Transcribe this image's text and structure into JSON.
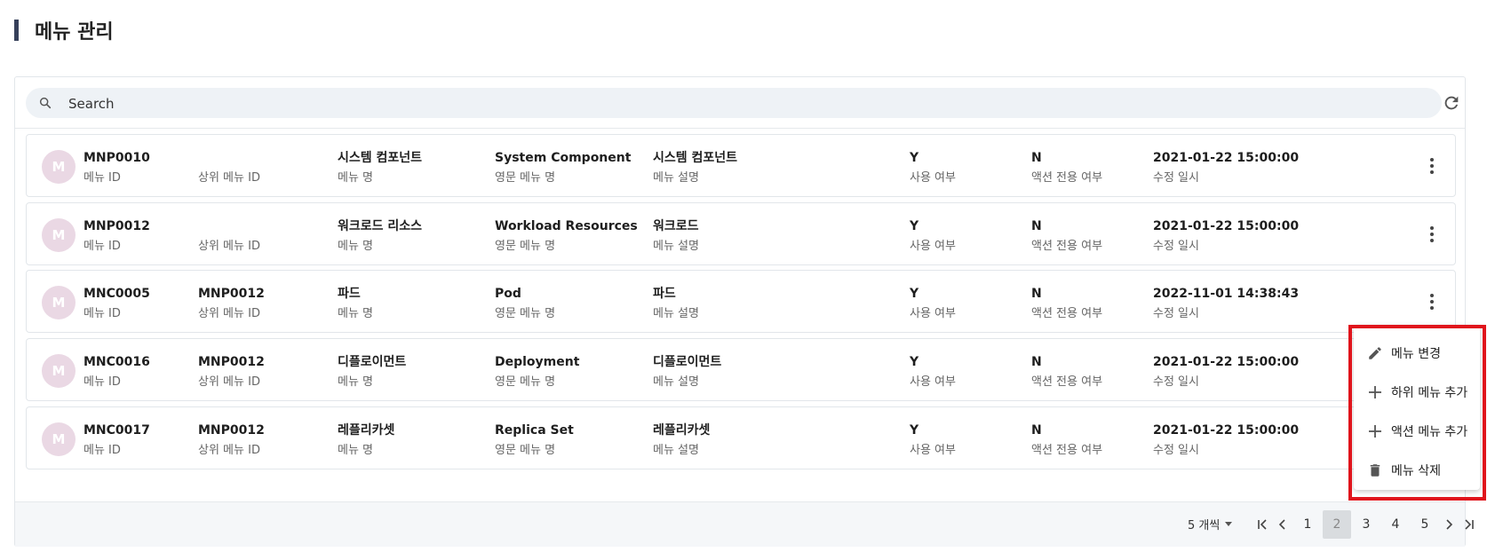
{
  "page": {
    "title": "메뉴 관리"
  },
  "search": {
    "placeholder": "Search"
  },
  "icons": {
    "search": "search-icon",
    "refresh": "refresh-icon",
    "more": "more-vertical-icon"
  },
  "labels": {
    "menu_id": "메뉴 ID",
    "parent_id": "상위 메뉴 ID",
    "menu_name": "메뉴 명",
    "eng_name": "영문 메뉴 명",
    "desc": "메뉴 설명",
    "use_yn": "사용 여부",
    "action_yn": "액션 전용 여부",
    "updated": "수정 일시"
  },
  "rows": [
    {
      "avatar": "M",
      "menu_id": "MNP0010",
      "parent_id": "",
      "menu_name": "시스템 컴포넌트",
      "eng_name": "System Component",
      "desc": "시스템 컴포넌트",
      "use_yn": "Y",
      "action_yn": "N",
      "updated": "2021-01-22 15:00:00"
    },
    {
      "avatar": "M",
      "menu_id": "MNP0012",
      "parent_id": "",
      "menu_name": "워크로드 리소스",
      "eng_name": "Workload Resources",
      "desc": "워크로드",
      "use_yn": "Y",
      "action_yn": "N",
      "updated": "2021-01-22 15:00:00"
    },
    {
      "avatar": "M",
      "menu_id": "MNC0005",
      "parent_id": "MNP0012",
      "menu_name": "파드",
      "eng_name": "Pod",
      "desc": "파드",
      "use_yn": "Y",
      "action_yn": "N",
      "updated": "2022-11-01 14:38:43"
    },
    {
      "avatar": "M",
      "menu_id": "MNC0016",
      "parent_id": "MNP0012",
      "menu_name": "디플로이먼트",
      "eng_name": "Deployment",
      "desc": "디플로이먼트",
      "use_yn": "Y",
      "action_yn": "N",
      "updated": "2021-01-22 15:00:00"
    },
    {
      "avatar": "M",
      "menu_id": "MNC0017",
      "parent_id": "MNP0012",
      "menu_name": "레플리카셋",
      "eng_name": "Replica Set",
      "desc": "레플리카셋",
      "use_yn": "Y",
      "action_yn": "N",
      "updated": "2021-01-22 15:00:00"
    }
  ],
  "context_menu": {
    "items": [
      {
        "icon": "pencil-icon",
        "label": "메뉴 변경"
      },
      {
        "icon": "plus-icon",
        "label": "하위 메뉴 추가"
      },
      {
        "icon": "plus-icon",
        "label": "액션 메뉴 추가"
      },
      {
        "icon": "trash-icon",
        "label": "메뉴 삭제"
      }
    ]
  },
  "pagination": {
    "page_size_label": "5 개씩",
    "pages": [
      "1",
      "2",
      "3",
      "4",
      "5"
    ],
    "current": "2"
  },
  "colors": {
    "highlight": "#e0141c",
    "avatar_bg": "#ead8e4",
    "title_bar": "#36405a"
  }
}
